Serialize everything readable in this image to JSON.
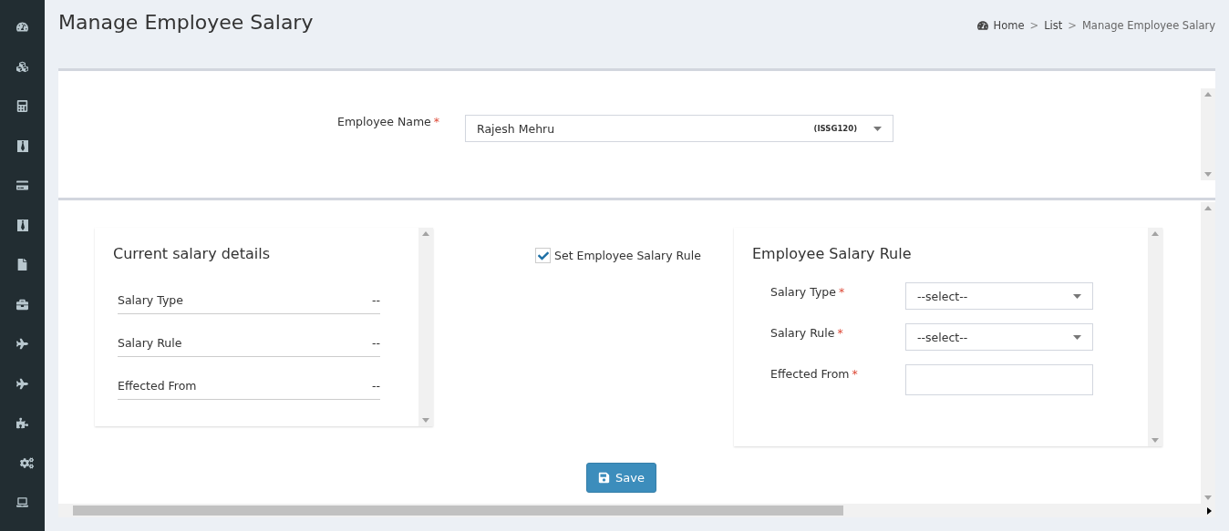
{
  "title": "Manage Employee Salary",
  "breadcrumb": [
    {
      "kind": "link",
      "label": "Home",
      "icon": true
    },
    {
      "kind": "separator",
      "label": ">"
    },
    {
      "kind": "link",
      "label": "List"
    },
    {
      "kind": "separator",
      "label": ">"
    },
    {
      "kind": "current",
      "label": "Manage Employee Salary"
    }
  ],
  "employee": {
    "label": "Employee Name",
    "mark": "*",
    "value": "Rajesh Mehru",
    "code": "(ISSG120)"
  },
  "current": {
    "title": "Current salary details",
    "rows": [
      {
        "label": "Salary Type",
        "value": "--"
      },
      {
        "label": "Salary Rule",
        "value": "--"
      },
      {
        "label": "Effected From",
        "value": "--"
      }
    ]
  },
  "rule_toggle": {
    "label": "Set Employee Salary Rule",
    "checked": true
  },
  "rule": {
    "title": "Employee Salary Rule",
    "fields": [
      {
        "kind": "select",
        "label": "Salary Type",
        "mark": "*",
        "value": "--select--"
      },
      {
        "kind": "select",
        "label": "Salary Rule",
        "mark": "*",
        "value": "--select--"
      },
      {
        "kind": "input",
        "label": "Effected From",
        "mark": "*"
      }
    ]
  },
  "save": "Save"
}
